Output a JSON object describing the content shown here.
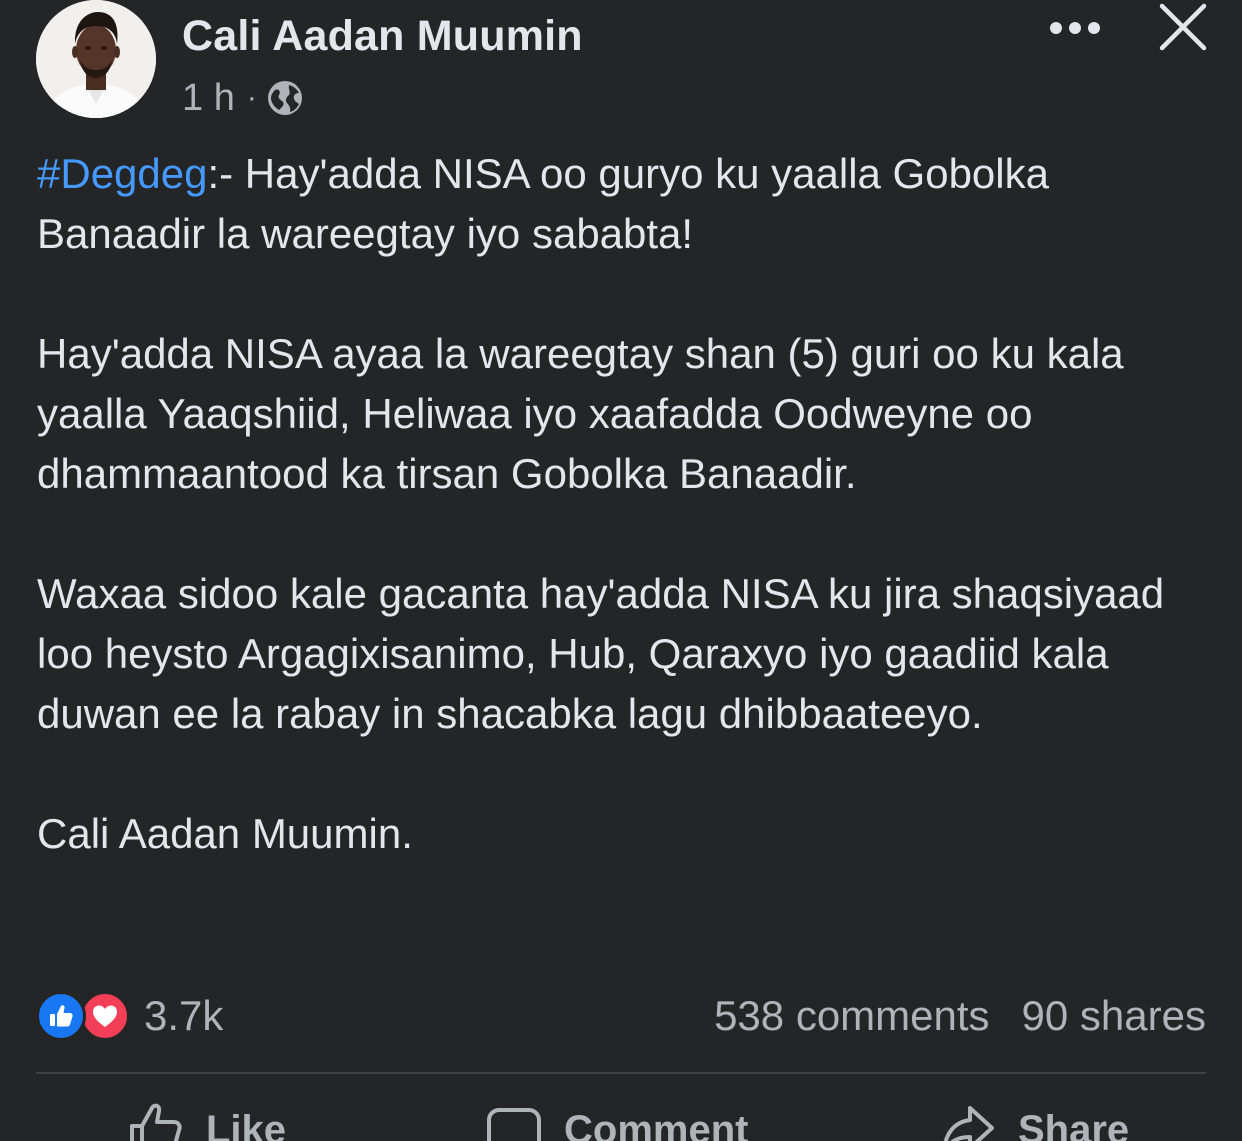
{
  "post": {
    "author": "Cali Aadan Muumin",
    "time": "1 h",
    "separator": "·",
    "privacy_icon": "globe-icon",
    "hashtag": "#Degdeg",
    "headline_rest": ":- Hay'adda NISA oo guryo ku yaalla Gobolka Banaadir la wareegtay iyo sababta!",
    "paragraph_2": "Hay'adda NISA ayaa la wareegtay shan (5) guri oo ku kala yaalla Yaaqshiid, Heliwaa iyo xaafadda Oodweyne oo dhammaantood ka tirsan Gobolka Banaadir.",
    "paragraph_3": "Waxaa sidoo kale gacanta hay'adda NISA ku jira shaqsiyaad loo heysto Argagixisanimo, Hub, Qaraxyo iyo gaadiid kala duwan ee la rabay in shacabka lagu dhibbaateeyo.",
    "paragraph_4": "Cali Aadan Muumin."
  },
  "stats": {
    "reactions": [
      "like",
      "love"
    ],
    "reaction_count": "3.7k",
    "comments": "538 comments",
    "shares": "90 shares"
  },
  "actions": {
    "like": "Like",
    "comment": "Comment",
    "share": "Share"
  },
  "colors": {
    "background": "#242526",
    "text": "#e4e6eb",
    "secondary_text": "#b0b3b8",
    "hashtag": "#4599ff",
    "like_blue": "#1877f2",
    "love_red": "#f33e58"
  }
}
